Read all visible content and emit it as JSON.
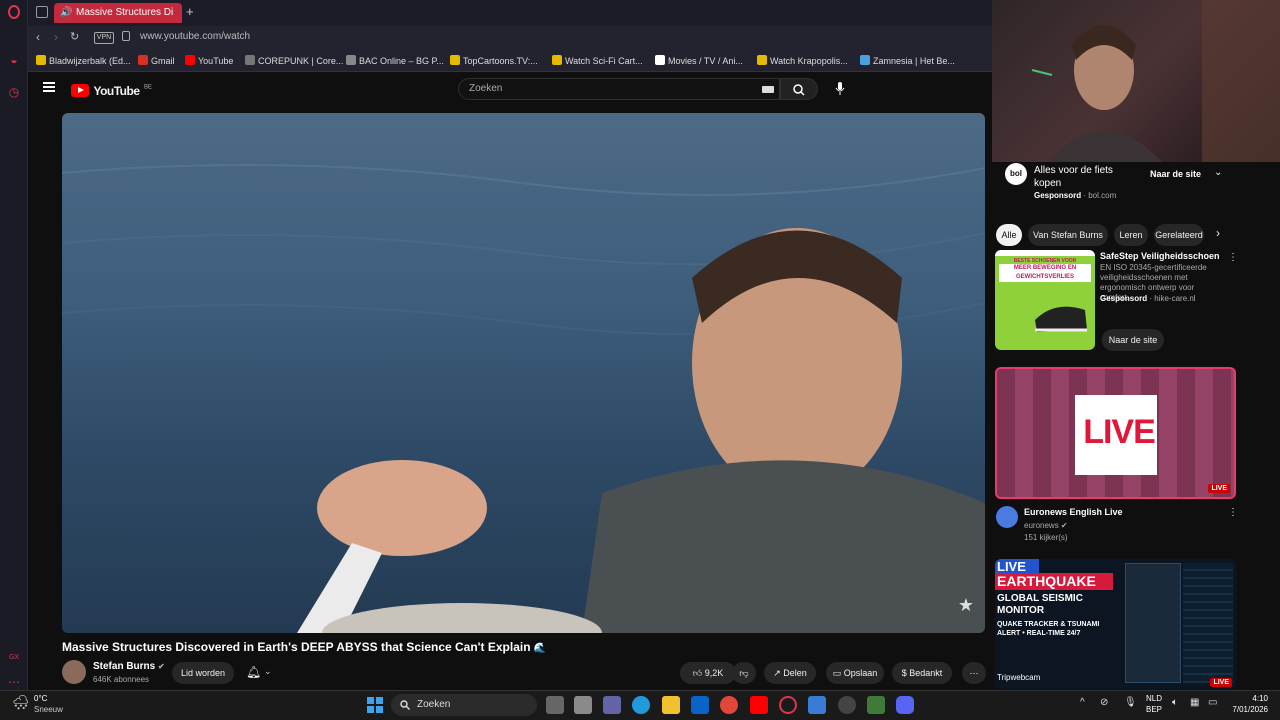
{
  "browser": {
    "tab_title": "Massive Structures Di",
    "url": "www.youtube.com/watch",
    "vpn_label": "VPN",
    "bookmarks": [
      {
        "label": "Bladwijzerbalk (Ed...",
        "color": "#e6b800"
      },
      {
        "label": "Gmail",
        "color": "#d93025"
      },
      {
        "label": "YouTube",
        "color": "#ff0000"
      },
      {
        "label": "COREPUNK | Core...",
        "color": "#777777"
      },
      {
        "label": "BAC Online – BG P...",
        "color": "#888888"
      },
      {
        "label": "TopCartoons.TV:...",
        "color": "#e6b800"
      },
      {
        "label": "Watch Sci-Fi Cart...",
        "color": "#e6b800"
      },
      {
        "label": "Movies / TV / Ani...",
        "color": "#ffffff"
      },
      {
        "label": "Watch Krapopolis...",
        "color": "#e6b800"
      },
      {
        "label": "Zamnesia | Het Be...",
        "color": "#4aa3df"
      }
    ]
  },
  "youtube": {
    "logo_text": "YouTube",
    "logo_country": "BE",
    "search_placeholder": "Zoeken",
    "video_title": "Massive Structures Discovered in Earth's DEEP ABYSS that Science Can't Explain",
    "channel_name": "Stefan Burns",
    "subscribers": "646K abonnees",
    "join_label": "Lid worden",
    "likes": "9,2K",
    "share_label": "Delen",
    "save_label": "Opslaan",
    "thanks_label": "Bedankt"
  },
  "sidebar": {
    "ad_top": {
      "title": "Alles voor de fiets kopen",
      "sponsored": "Gesponsord",
      "domain": "bol.com",
      "cta": "Naar de site",
      "logo": "bol"
    },
    "chips": [
      "Alle",
      "Van Stefan Burns",
      "Leren",
      "Gerelateerd"
    ],
    "ad_item": {
      "title": "SafeStep Veiligheidsschoen",
      "description": "EN ISO 20345-gecertificeerde veiligheidsschoenen met ergonomisch ontwerp voor comfort.",
      "sponsored": "Gesponsord",
      "domain": "hike-care.nl",
      "cta": "Naar de site",
      "thumb_banner_small": "BESTE SCHOENEN VOOR",
      "thumb_banner_big": "MEER BEWEGING EN GEWICHTSVERLIES"
    },
    "live_item": {
      "thumb_text": "LIVE",
      "badge": "LIVE",
      "title": "Euronews English Live",
      "channel": "euronews",
      "viewers": "151 kijker(s)"
    },
    "quake_item": {
      "line1": "LIVE",
      "line2": "EARTHQUAKE",
      "line3": "GLOBAL SEISMIC",
      "line4": "MONITOR",
      "line5": "QUAKE TRACKER & TSUNAMI",
      "line6": "ALERT • REAL-TIME 24/7",
      "badge": "LIVE",
      "brand": "Tripwebcam"
    }
  },
  "taskbar": {
    "weather_temp": "0°C",
    "weather_desc": "Sneeuw",
    "search_label": "Zoeken",
    "lang1": "NLD",
    "lang2": "BEP",
    "time": "4:10",
    "date": "7/01/2026"
  },
  "colors": {
    "opera_red": "#c42a3d",
    "yt_red": "#ff0000",
    "live_pink": "#e83a6f"
  }
}
